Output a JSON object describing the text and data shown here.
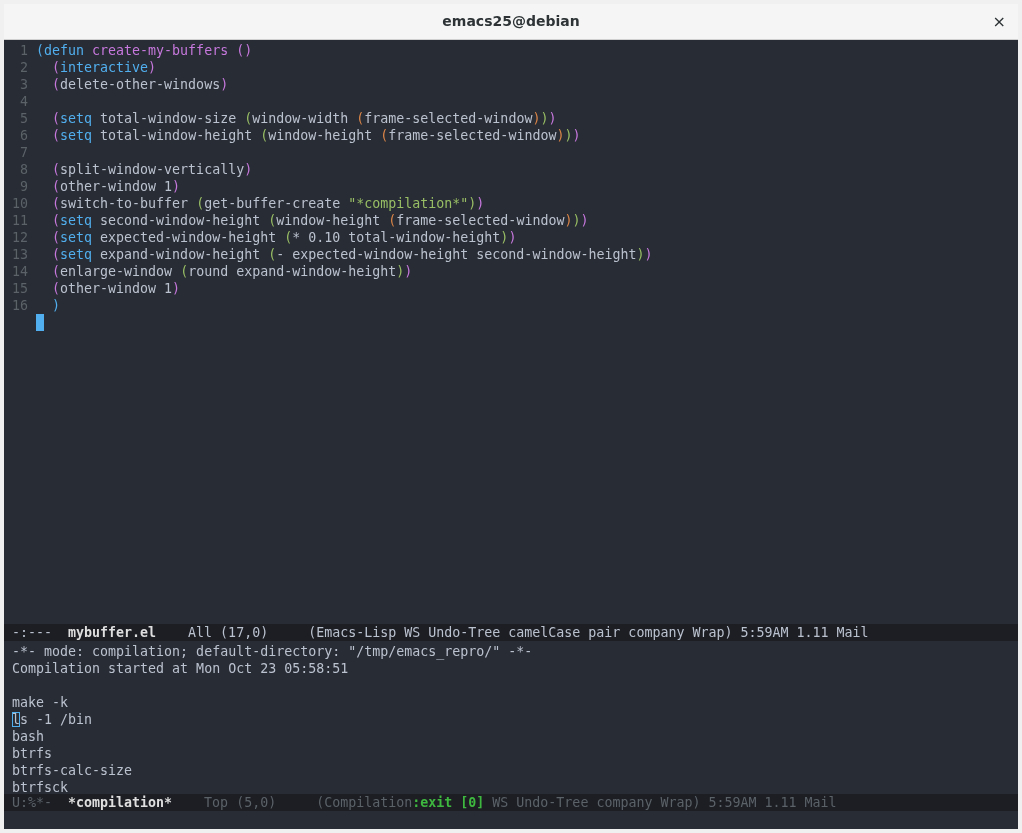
{
  "window": {
    "title": "emacs25@debian",
    "close": "×"
  },
  "editor": {
    "lines": [
      {
        "number": "1",
        "cursor": false,
        "tokens": [
          {
            "kind": "p1",
            "text": "("
          },
          {
            "kind": "keyword",
            "text": "defun"
          },
          {
            "kind": "name",
            "text": " create-my-buffers"
          },
          {
            "kind": "p2",
            "text": " ()"
          }
        ]
      },
      {
        "number": "2",
        "cursor": false,
        "tokens": [
          {
            "kind": "p2",
            "text": "  ("
          },
          {
            "kind": "keyword",
            "text": "interactive"
          },
          {
            "kind": "p2",
            "text": ")"
          }
        ]
      },
      {
        "number": "3",
        "cursor": false,
        "tokens": [
          {
            "kind": "p2",
            "text": "  ("
          },
          {
            "kind": "text",
            "text": "delete-other-windows"
          },
          {
            "kind": "p2",
            "text": ")"
          }
        ]
      },
      {
        "number": "4",
        "cursor": false
      },
      {
        "number": "5",
        "cursor": false,
        "tokens": [
          {
            "kind": "p2",
            "text": "  ("
          },
          {
            "kind": "keyword",
            "text": "setq"
          },
          {
            "kind": "text",
            "text": " total-window-size "
          },
          {
            "kind": "p3",
            "text": "("
          },
          {
            "kind": "text",
            "text": "window-width "
          },
          {
            "kind": "p4",
            "text": "("
          },
          {
            "kind": "text",
            "text": "frame-selected-window"
          },
          {
            "kind": "p4",
            "text": ")"
          },
          {
            "kind": "p3",
            "text": ")"
          },
          {
            "kind": "p2",
            "text": ")"
          }
        ]
      },
      {
        "number": "6",
        "cursor": false,
        "tokens": [
          {
            "kind": "p2",
            "text": "  ("
          },
          {
            "kind": "keyword",
            "text": "setq"
          },
          {
            "kind": "text",
            "text": " total-window-height "
          },
          {
            "kind": "p3",
            "text": "("
          },
          {
            "kind": "text",
            "text": "window-height "
          },
          {
            "kind": "p4",
            "text": "("
          },
          {
            "kind": "text",
            "text": "frame-selected-window"
          },
          {
            "kind": "p4",
            "text": ")"
          },
          {
            "kind": "p3",
            "text": ")"
          },
          {
            "kind": "p2",
            "text": ")"
          }
        ]
      },
      {
        "number": "7",
        "cursor": false
      },
      {
        "number": "8",
        "cursor": false,
        "tokens": [
          {
            "kind": "p2",
            "text": "  ("
          },
          {
            "kind": "text",
            "text": "split-window-vertically"
          },
          {
            "kind": "p2",
            "text": ")"
          }
        ]
      },
      {
        "number": "9",
        "cursor": false,
        "tokens": [
          {
            "kind": "p2",
            "text": "  ("
          },
          {
            "kind": "text",
            "text": "other-window 1"
          },
          {
            "kind": "p2",
            "text": ")"
          }
        ]
      },
      {
        "number": "10",
        "cursor": false,
        "tokens": [
          {
            "kind": "p2",
            "text": "  ("
          },
          {
            "kind": "text",
            "text": "switch-to-buffer "
          },
          {
            "kind": "p3",
            "text": "("
          },
          {
            "kind": "text",
            "text": "get-buffer-create "
          },
          {
            "kind": "string",
            "text": "\"*compilation*\""
          },
          {
            "kind": "p3",
            "text": ")"
          },
          {
            "kind": "p2",
            "text": ")"
          }
        ]
      },
      {
        "number": "11",
        "cursor": false,
        "tokens": [
          {
            "kind": "p2",
            "text": "  ("
          },
          {
            "kind": "keyword",
            "text": "setq"
          },
          {
            "kind": "text",
            "text": " second-window-height "
          },
          {
            "kind": "p3",
            "text": "("
          },
          {
            "kind": "text",
            "text": "window-height "
          },
          {
            "kind": "p4",
            "text": "("
          },
          {
            "kind": "text",
            "text": "frame-selected-window"
          },
          {
            "kind": "p4",
            "text": ")"
          },
          {
            "kind": "p3",
            "text": ")"
          },
          {
            "kind": "p2",
            "text": ")"
          }
        ]
      },
      {
        "number": "12",
        "cursor": false,
        "tokens": [
          {
            "kind": "p2",
            "text": "  ("
          },
          {
            "kind": "keyword",
            "text": "setq"
          },
          {
            "kind": "text",
            "text": " expected-window-height "
          },
          {
            "kind": "p3",
            "text": "("
          },
          {
            "kind": "text",
            "text": "* 0.10 total-window-height"
          },
          {
            "kind": "p3",
            "text": ")"
          },
          {
            "kind": "p2",
            "text": ")"
          }
        ]
      },
      {
        "number": "13",
        "cursor": false,
        "tokens": [
          {
            "kind": "p2",
            "text": "  ("
          },
          {
            "kind": "keyword",
            "text": "setq"
          },
          {
            "kind": "text",
            "text": " expand-window-height "
          },
          {
            "kind": "p3",
            "text": "("
          },
          {
            "kind": "text",
            "text": "- expected-window-height second-window-height"
          },
          {
            "kind": "p3",
            "text": ")"
          },
          {
            "kind": "p2",
            "text": ")"
          }
        ]
      },
      {
        "number": "14",
        "cursor": false,
        "tokens": [
          {
            "kind": "p2",
            "text": "  ("
          },
          {
            "kind": "text",
            "text": "enlarge-window "
          },
          {
            "kind": "p3",
            "text": "("
          },
          {
            "kind": "text",
            "text": "round expand-window-height"
          },
          {
            "kind": "p3",
            "text": ")"
          },
          {
            "kind": "p2",
            "text": ")"
          }
        ]
      },
      {
        "number": "15",
        "cursor": false,
        "tokens": [
          {
            "kind": "p2",
            "text": "  ("
          },
          {
            "kind": "text",
            "text": "other-window 1"
          },
          {
            "kind": "p2",
            "text": ")"
          }
        ]
      },
      {
        "number": "16",
        "cursor": false,
        "tokens": [
          {
            "kind": "p1",
            "text": "  )"
          }
        ]
      },
      {
        "cursor": true
      }
    ]
  },
  "top_mode_line": {
    "active": true,
    "status": "-:---",
    "buffer": "mybuffer.el",
    "position": "All (17,0)",
    "modes": [
      {
        "kind": "text",
        "text": "(Emacs-Lisp WS Undo-Tree camelCase pair company Wrap) 5:59AM 1.11 Mail"
      }
    ]
  },
  "compilation": {
    "lines": [
      {
        "text": "-*- mode: compilation; default-directory: \"/tmp/emacs_repro/\" -*-",
        "cursor": false
      },
      {
        "text": "Compilation started at Mon Oct 23 05:58:51",
        "cursor": false
      }
    ],
    "output_lines": [
      {
        "text": "make -k",
        "cursor": false
      },
      {
        "text": "ls -1 /bin",
        "cursor": true
      },
      {
        "text": "bash",
        "cursor": false
      },
      {
        "text": "btrfs",
        "cursor": false
      },
      {
        "text": "btrfs-calc-size",
        "cursor": false
      },
      {
        "text": "btrfsck",
        "cursor": false
      }
    ]
  },
  "bottom_mode_line": {
    "active": false,
    "status": "U:%*-",
    "buffer": "*compilation*",
    "position": "Top (5,0)",
    "modes": [
      {
        "kind": "text",
        "text": "(Compilation"
      },
      {
        "kind": "exit",
        "text": ":exit [0]"
      },
      {
        "kind": "text",
        "text": " WS Undo-Tree company Wrap) 5:59AM 1.11 Mail"
      }
    ]
  }
}
